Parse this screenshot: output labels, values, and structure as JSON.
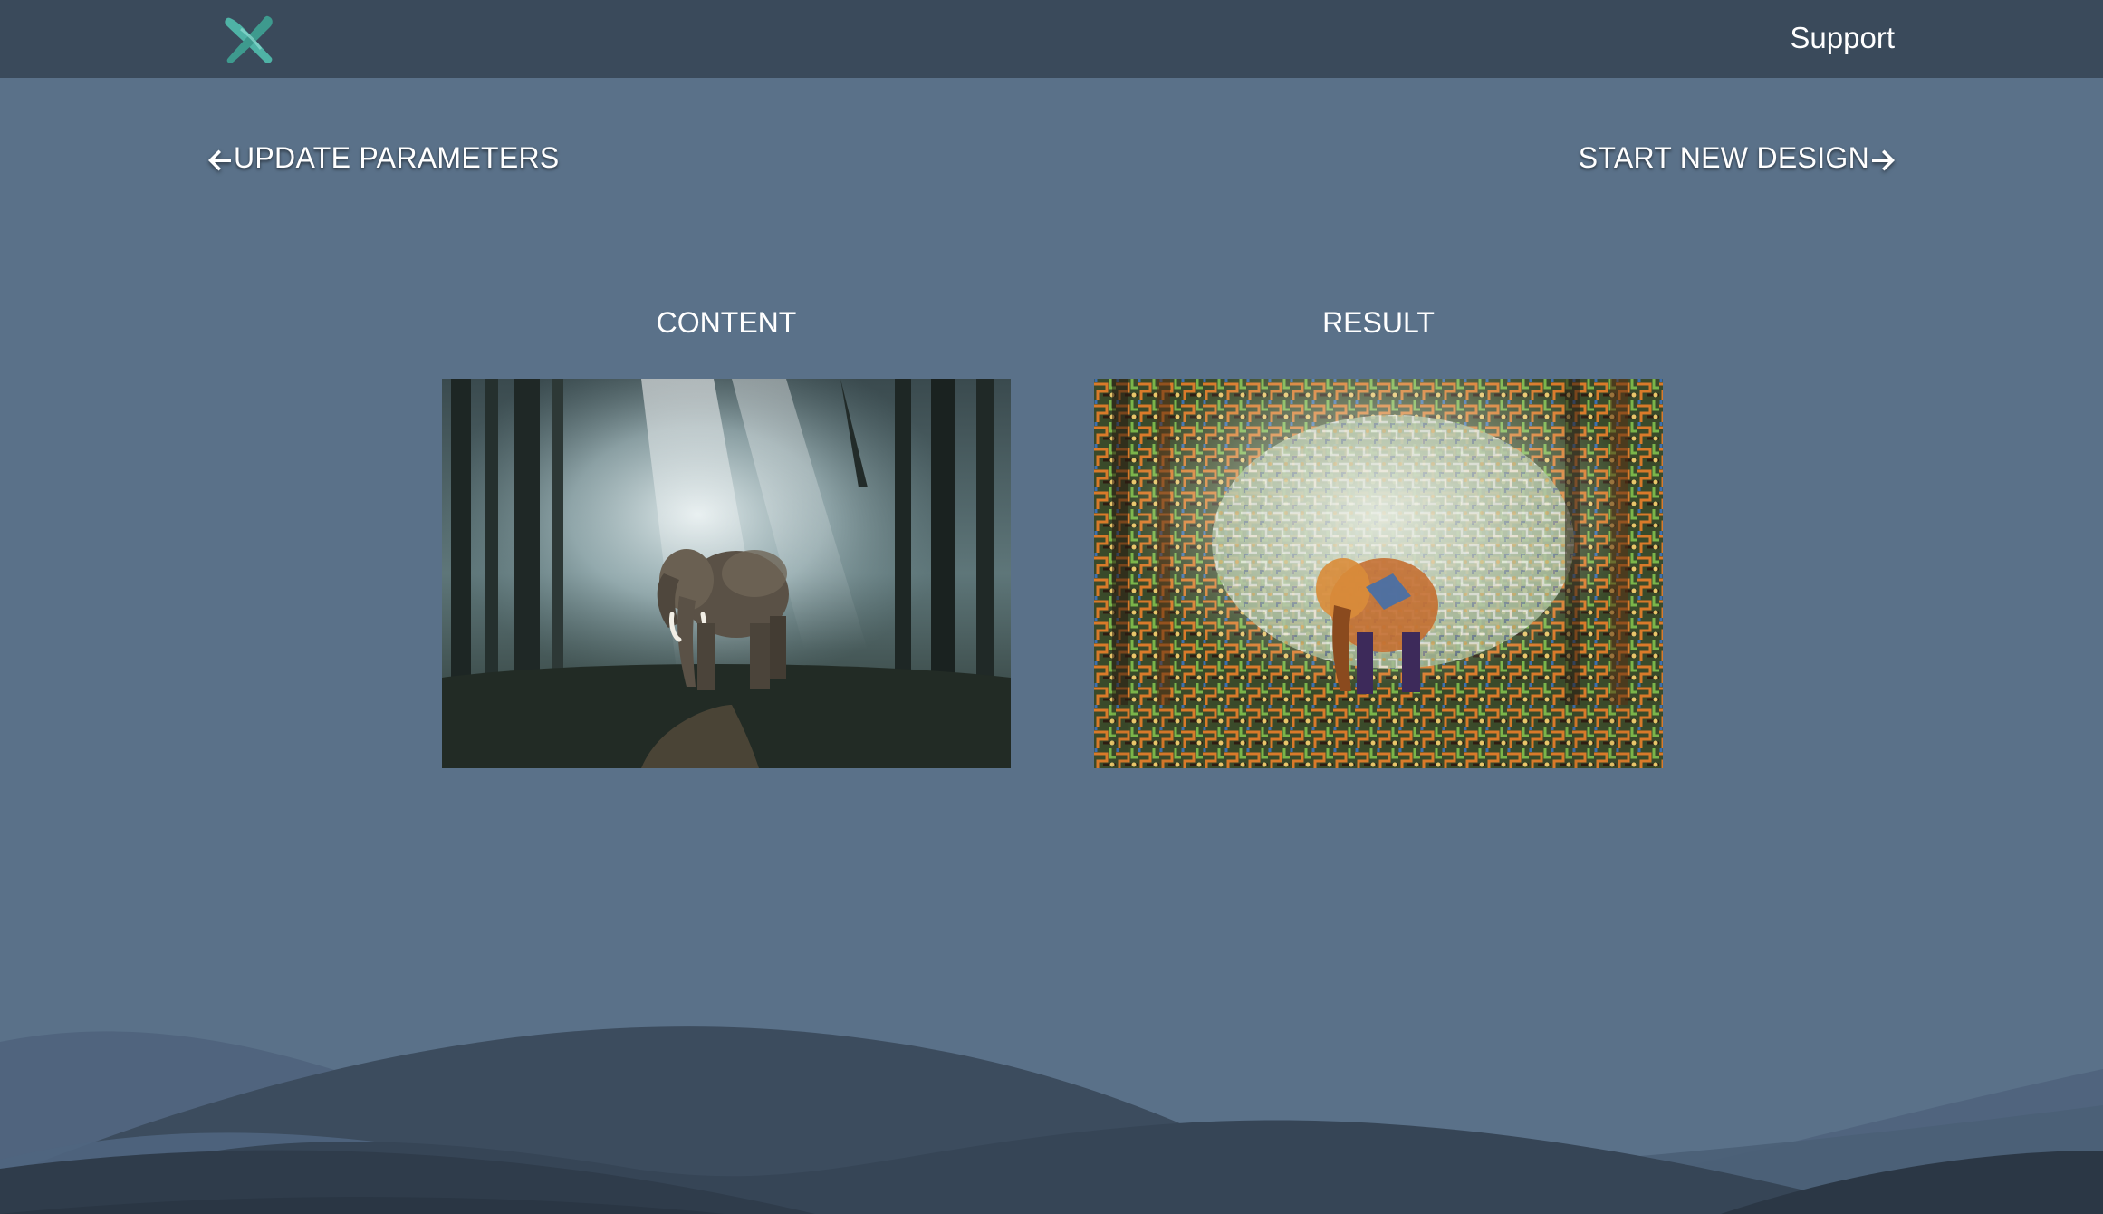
{
  "header": {
    "logo_icon": "brush-x-logo-icon",
    "support_label": "Support"
  },
  "nav": {
    "back_label": "UPDATE PARAMETERS",
    "back_icon": "arrow-left-icon",
    "forward_label": "START NEW DESIGN",
    "forward_icon": "arrow-right-icon"
  },
  "panels": {
    "content_label": "CONTENT",
    "result_label": "RESULT"
  },
  "colors": {
    "background": "#5a7189",
    "header": "#3a4a5b",
    "text": "#ffffff",
    "logo_accent": "#4fb3a6"
  }
}
